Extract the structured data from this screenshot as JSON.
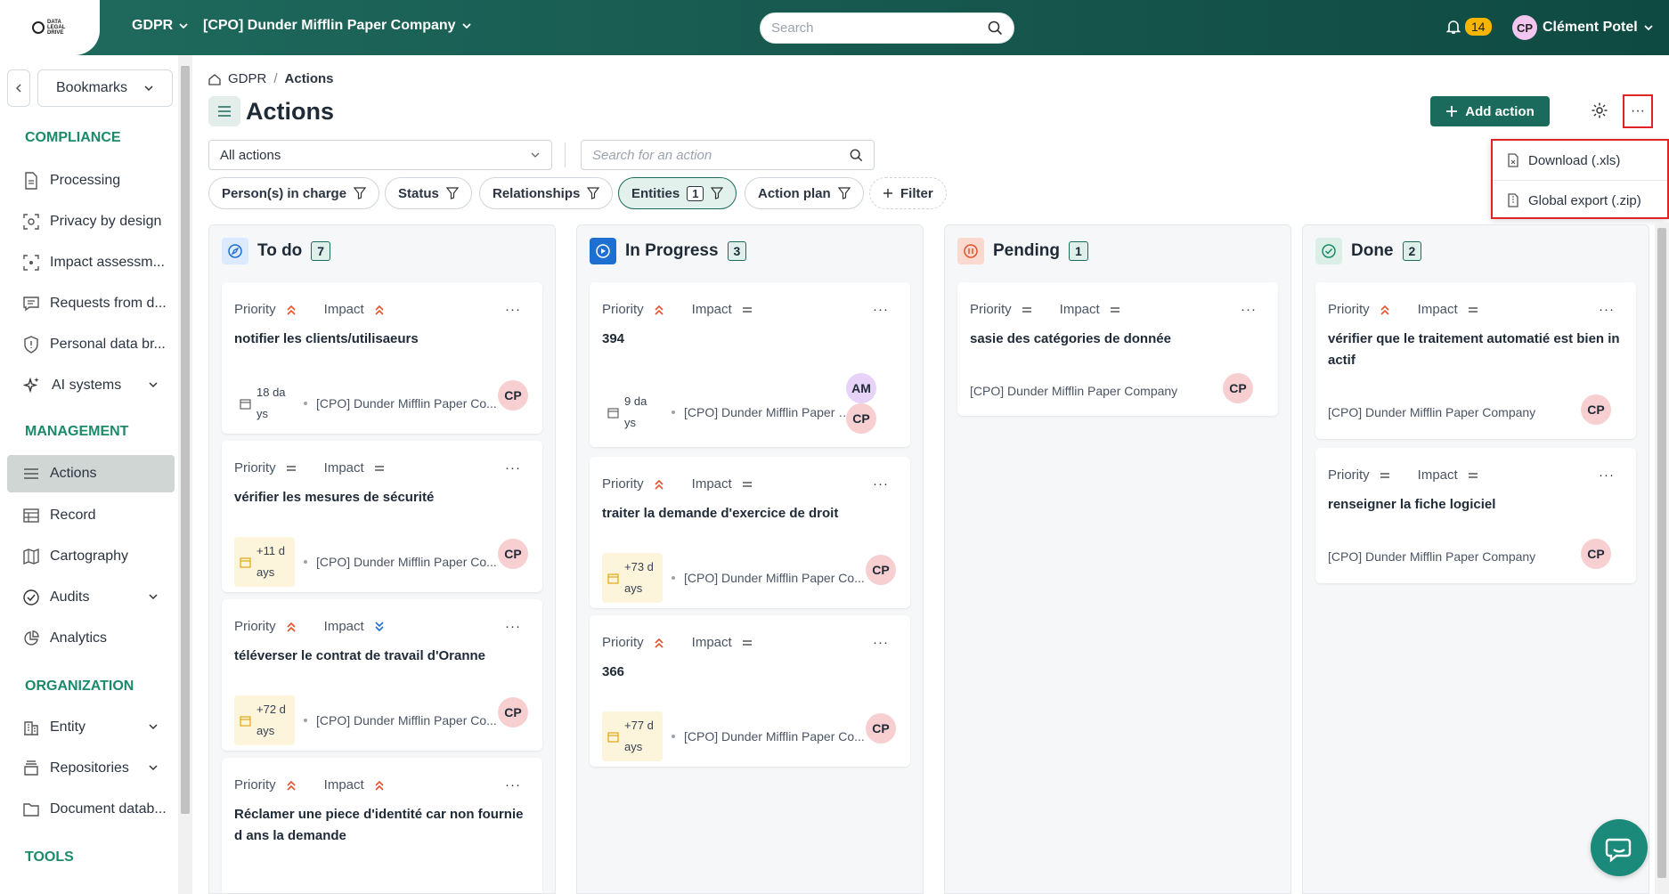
{
  "topbar": {
    "logo_text": "DATA LEGAL DRIVE",
    "module": "GDPR",
    "organization": "[CPO] Dunder Mifflin Paper Company",
    "search_placeholder": "Search",
    "notifications": "14",
    "user_initials": "CP",
    "user_name": "Clément Potel"
  },
  "sidebar": {
    "bookmarks": "Bookmarks",
    "sections": {
      "compliance": "COMPLIANCE",
      "management": "MANAGEMENT",
      "organization": "ORGANIZATION",
      "tools": "TOOLS"
    },
    "items": [
      {
        "label": "Processing"
      },
      {
        "label": "Privacy by design"
      },
      {
        "label": "Impact assessm..."
      },
      {
        "label": "Requests from d..."
      },
      {
        "label": "Personal data br..."
      },
      {
        "label": "AI systems"
      },
      {
        "label": "Actions"
      },
      {
        "label": "Record"
      },
      {
        "label": "Cartography"
      },
      {
        "label": "Audits"
      },
      {
        "label": "Analytics"
      },
      {
        "label": "Entity"
      },
      {
        "label": "Repositories"
      },
      {
        "label": "Document datab..."
      }
    ]
  },
  "breadcrumb": {
    "root": "GDPR",
    "sep": "/",
    "current": "Actions"
  },
  "page": {
    "title": "Actions",
    "add_button": "Add action",
    "more": "···",
    "menu": {
      "download": "Download (.xls)",
      "export": "Global export (.zip)"
    },
    "filter_select": "All actions",
    "search_placeholder": "Search for an action"
  },
  "filters": {
    "persons": "Person(s) in charge",
    "status": "Status",
    "relationships": "Relationships",
    "entities": "Entities",
    "entities_count": "1",
    "action_plan": "Action plan",
    "add_filter": "Filter"
  },
  "columns": [
    {
      "title": "To do",
      "count": "7",
      "cards": [
        {
          "priority": "Priority",
          "impact": "Impact",
          "title": "notifier les clients/utilisaeurs",
          "due": "18 da ys",
          "entity": "[CPO] Dunder Mifflin Paper Co...",
          "owner": "CP"
        },
        {
          "priority": "Priority",
          "impact": "Impact",
          "title": "vérifier les mesures de sécurité",
          "due": "+11 d ays",
          "entity": "[CPO] Dunder Mifflin Paper Co...",
          "owner": "CP"
        },
        {
          "priority": "Priority",
          "impact": "Impact",
          "title": "téléverser le contrat de travail d'Oranne",
          "due": "+72 d ays",
          "entity": "[CPO] Dunder Mifflin Paper Co...",
          "owner": "CP"
        },
        {
          "priority": "Priority",
          "impact": "Impact",
          "title": "Réclamer une piece d'identité car non fournie d ans la demande"
        }
      ]
    },
    {
      "title": "In Progress",
      "count": "3",
      "cards": [
        {
          "priority": "Priority",
          "impact": "Impact",
          "title": "394",
          "due": "9 da ys",
          "entity": "[CPO] Dunder Mifflin Paper C...",
          "owner": "CP",
          "owner2": "AM"
        },
        {
          "priority": "Priority",
          "impact": "Impact",
          "title": "traiter la demande d'exercice de droit",
          "due": "+73 d ays",
          "entity": "[CPO] Dunder Mifflin Paper Co...",
          "owner": "CP"
        },
        {
          "priority": "Priority",
          "impact": "Impact",
          "title": "366",
          "due": "+77 d ays",
          "entity": "[CPO] Dunder Mifflin Paper Co...",
          "owner": "CP"
        }
      ]
    },
    {
      "title": "Pending",
      "count": "1",
      "cards": [
        {
          "priority": "Priority",
          "impact": "Impact",
          "title": "sasie des catégories de donnée",
          "entity": "[CPO] Dunder Mifflin Paper Company",
          "owner": "CP"
        }
      ]
    },
    {
      "title": "Done",
      "count": "2",
      "cards": [
        {
          "priority": "Priority",
          "impact": "Impact",
          "title": "vérifier que le traitement automatié est bien in actif",
          "entity": "[CPO] Dunder Mifflin Paper Company",
          "owner": "CP"
        },
        {
          "priority": "Priority",
          "impact": "Impact",
          "title": "renseigner la fiche logiciel",
          "entity": "[CPO] Dunder Mifflin Paper Company",
          "owner": "CP"
        }
      ]
    }
  ],
  "colors": {
    "brand": "#1b6b5c",
    "accent": "#1b8a6b",
    "high": "#e2532d",
    "low": "#1d6fd1"
  }
}
